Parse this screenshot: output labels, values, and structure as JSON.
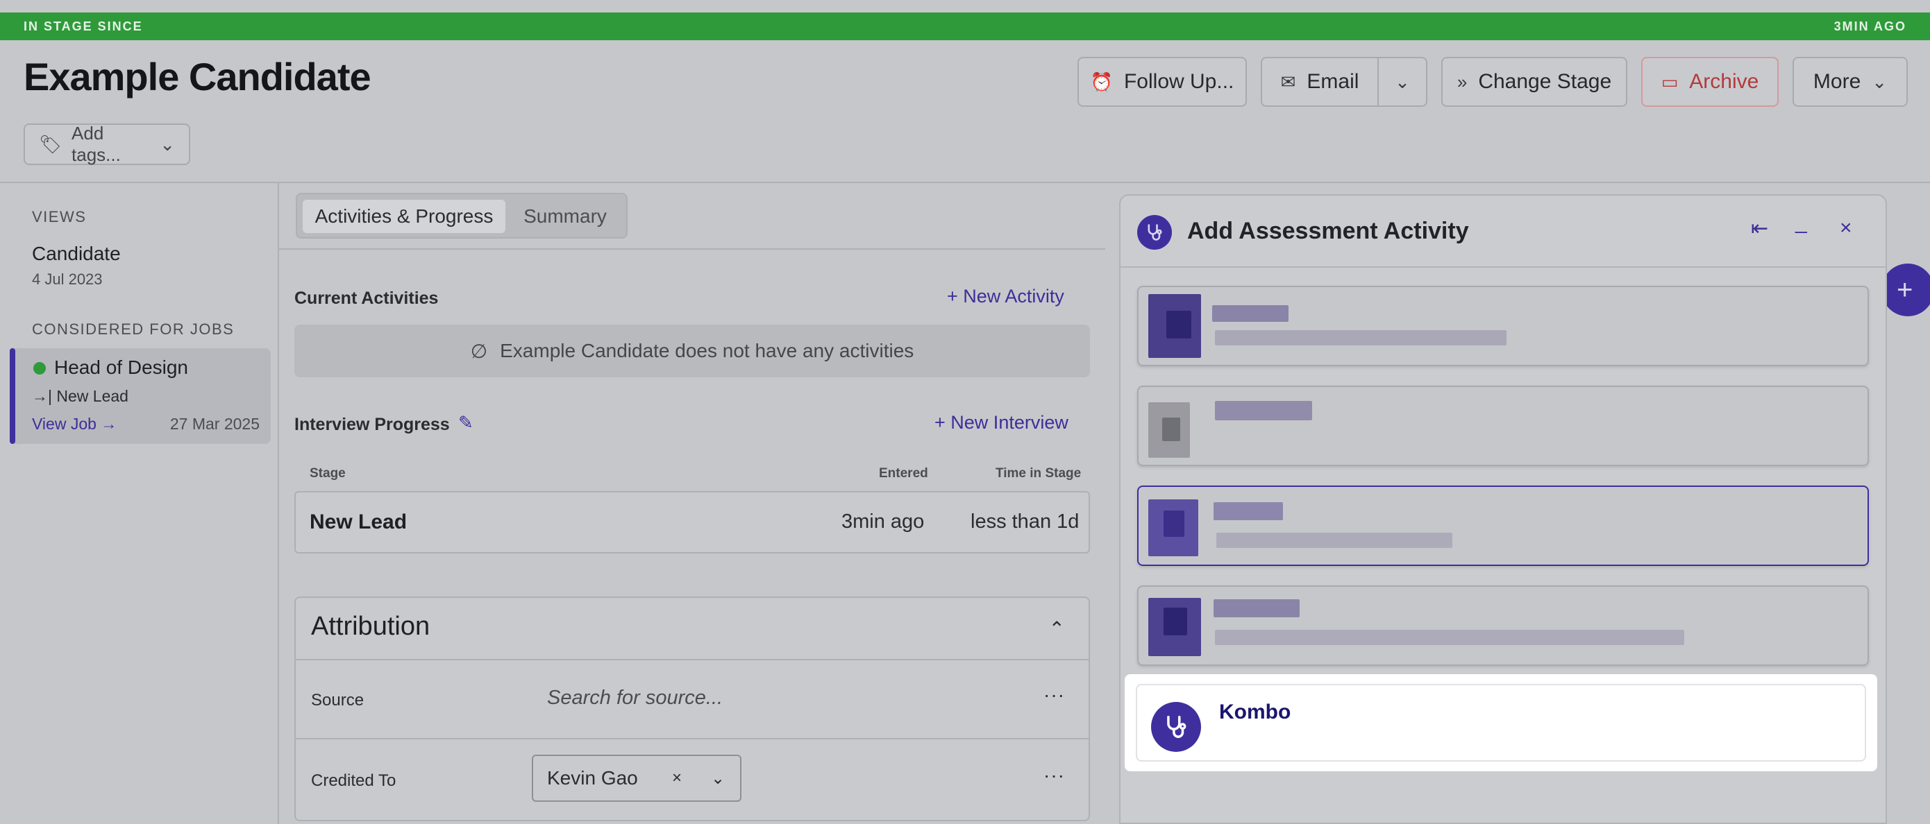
{
  "banner": {
    "left": "IN STAGE SINCE",
    "right": "3MIN AGO"
  },
  "candidate": {
    "name": "Example Candidate"
  },
  "header_actions": {
    "follow_up": "Follow Up...",
    "email": "Email",
    "change_stage": "Change Stage",
    "archive": "Archive",
    "more": "More"
  },
  "tags": {
    "placeholder": "Add tags..."
  },
  "sidebar": {
    "views_label": "VIEWS",
    "candidate_label": "Candidate",
    "candidate_date": "4 Jul 2023",
    "jobs_label": "CONSIDERED FOR JOBS",
    "job": {
      "name": "Head of Design",
      "stage": "New Lead",
      "view_link": "View Job",
      "date": "27 Mar 2025"
    }
  },
  "tabs": [
    {
      "label": "Activities & Progress"
    },
    {
      "label": "Summary"
    }
  ],
  "activities": {
    "title": "Current Activities",
    "new_link": "New Activity",
    "empty_text": "Example Candidate does not have any activities"
  },
  "interview": {
    "title": "Interview Progress",
    "new_link": "New Interview",
    "columns": {
      "stage": "Stage",
      "entered": "Entered",
      "time_in_stage": "Time in Stage"
    },
    "row": {
      "stage": "New Lead",
      "entered": "3min ago",
      "time_in_stage": "less than 1d"
    }
  },
  "attribution": {
    "title": "Attribution",
    "source_label": "Source",
    "source_placeholder": "Search for source...",
    "credited_label": "Credited To",
    "credited_value": "Kevin Gao"
  },
  "modal": {
    "title": "Add Assessment Activity",
    "highlighted_option": "Kombo"
  },
  "colors": {
    "accent": "#3f2f9e",
    "banner": "#2f9a3a",
    "archive": "#b23b3b"
  }
}
